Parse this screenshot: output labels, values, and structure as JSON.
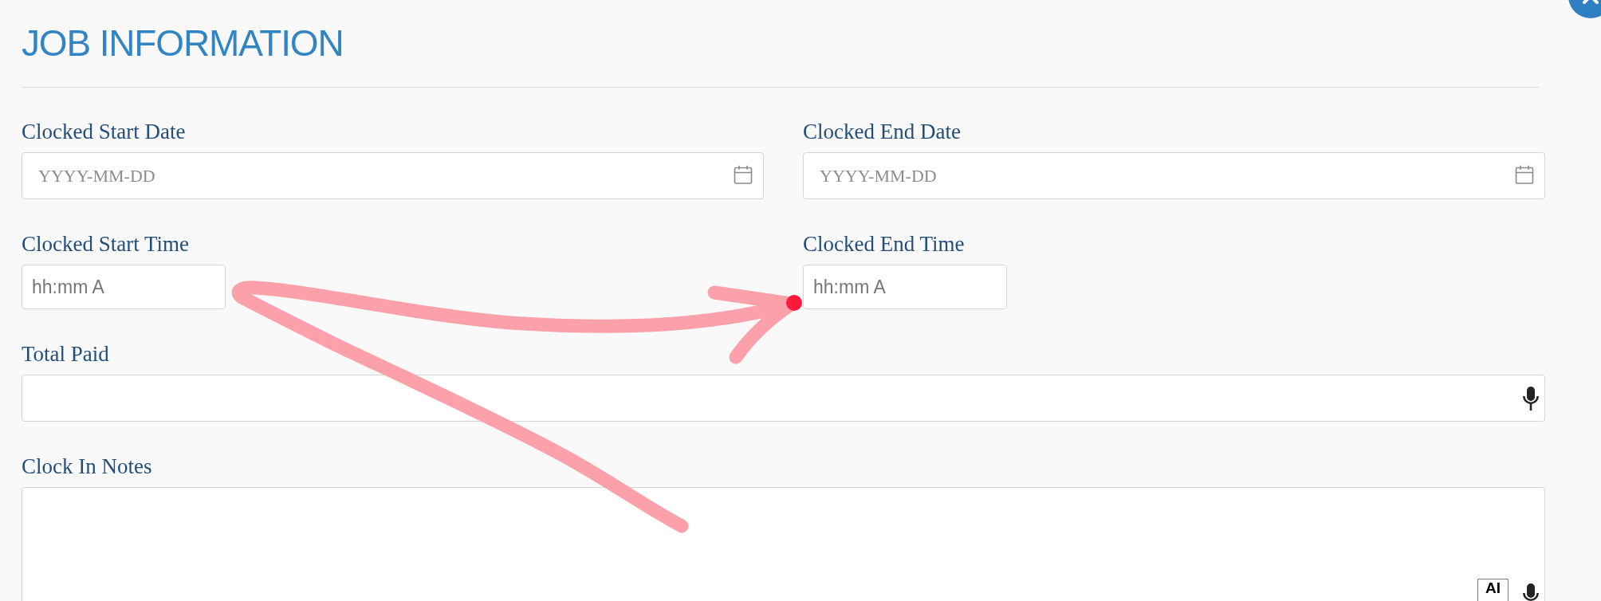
{
  "header": {
    "title": "JOB INFORMATION"
  },
  "fields": [
    {
      "kind": "date",
      "label": "Clocked Start Date",
      "placeholder": "YYYY-MM-DD"
    },
    {
      "kind": "date",
      "label": "Clocked End Date",
      "placeholder": "YYYY-MM-DD"
    },
    {
      "kind": "time",
      "label": "Clocked Start Time",
      "placeholder": "hh:mm A"
    },
    {
      "kind": "time",
      "label": "Clocked End Time",
      "placeholder": "hh:mm A"
    },
    {
      "kind": "voice_text",
      "label": "Total Paid"
    },
    {
      "kind": "notes",
      "label": "Clock In Notes",
      "ai_badge": "AI"
    }
  ]
}
